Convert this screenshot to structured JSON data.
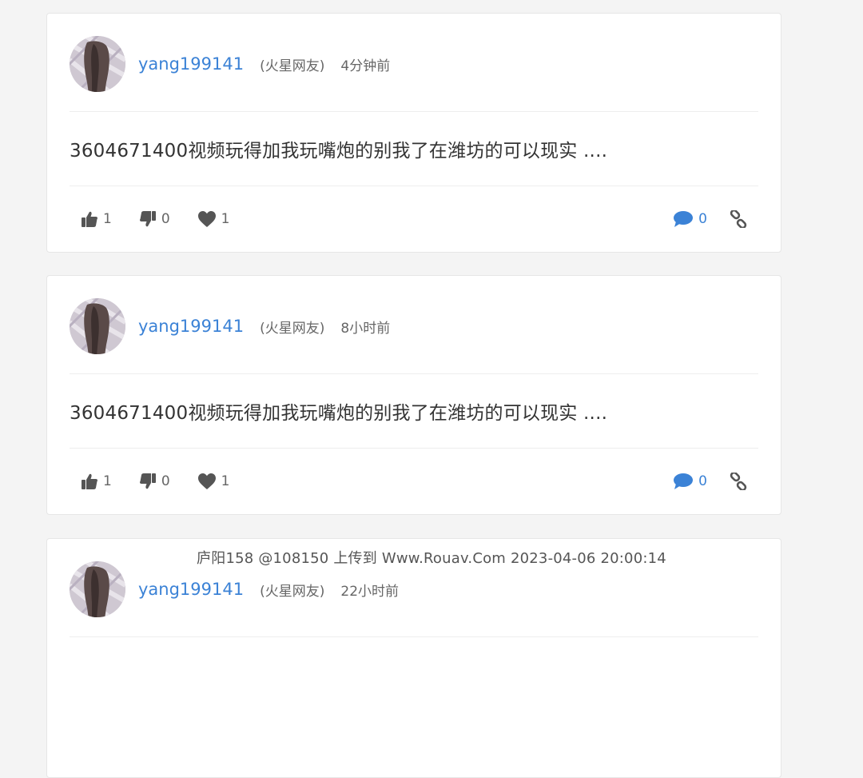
{
  "posts": [
    {
      "username": "yang199141",
      "role": "(火星网友)",
      "time": "4分钟前",
      "content": "3604671400视频玩得加我玩嘴炮的别我了在潍坊的可以现实 ....",
      "likes": "1",
      "dislikes": "0",
      "favorites": "1",
      "comments": "0"
    },
    {
      "username": "yang199141",
      "role": "(火星网友)",
      "time": "8小时前",
      "content": "3604671400视频玩得加我玩嘴炮的别我了在潍坊的可以现实 ....",
      "likes": "1",
      "dislikes": "0",
      "favorites": "1",
      "comments": "0"
    },
    {
      "username": "yang199141",
      "role": "(火星网友)",
      "time": "22小时前",
      "content": "",
      "likes": "",
      "dislikes": "",
      "favorites": "",
      "comments": ""
    }
  ],
  "watermark": "庐阳158 @108150 上传到 Www.Rouav.Com 2023-04-06 20:00:14",
  "colors": {
    "accent": "#3b82d6",
    "text": "#333333",
    "muted": "#666666",
    "background": "#f4f4f4"
  },
  "icons": [
    "thumbs-up-icon",
    "thumbs-down-icon",
    "heart-icon",
    "comment-icon",
    "link-icon"
  ]
}
